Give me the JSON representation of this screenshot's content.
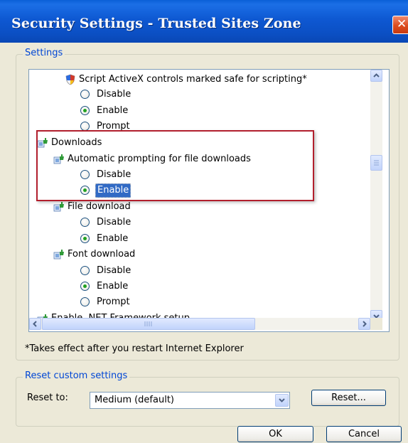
{
  "window": {
    "title": "Security Settings - Trusted Sites Zone",
    "close_glyph": "✕"
  },
  "settings": {
    "legend": "Settings",
    "items": [
      {
        "label": "Script ActiveX controls marked safe for scripting*",
        "icon": "activex-shield-icon"
      },
      {
        "label": "Disable",
        "selected": false
      },
      {
        "label": "Enable",
        "selected": true
      },
      {
        "label": "Prompt",
        "selected": false
      },
      {
        "label": "Downloads",
        "icon": "downloads-icon"
      },
      {
        "label": "Automatic prompting for file downloads",
        "icon": "downloads-icon"
      },
      {
        "label": "Disable",
        "selected": false
      },
      {
        "label": "Enable",
        "selected": true
      },
      {
        "label": "File download",
        "icon": "downloads-icon"
      },
      {
        "label": "Disable",
        "selected": false
      },
      {
        "label": "Enable",
        "selected": true
      },
      {
        "label": "Font download",
        "icon": "downloads-icon"
      },
      {
        "label": "Disable",
        "selected": false
      },
      {
        "label": "Enable",
        "selected": true
      },
      {
        "label": "Prompt",
        "selected": false
      },
      {
        "label": "Enable .NET Framework setup",
        "icon": "downloads-icon"
      }
    ],
    "footnote": "*Takes effect after you restart Internet Explorer"
  },
  "reset": {
    "legend": "Reset custom settings",
    "label": "Reset to:",
    "selected": "Medium (default)",
    "button": "Reset..."
  },
  "buttons": {
    "ok": "OK",
    "cancel": "Cancel"
  },
  "colors": {
    "titlebar": "#0a5fd7",
    "dialog": "#ece9d8",
    "highlight_border": "#b21f2d",
    "selection": "#316ac5"
  }
}
